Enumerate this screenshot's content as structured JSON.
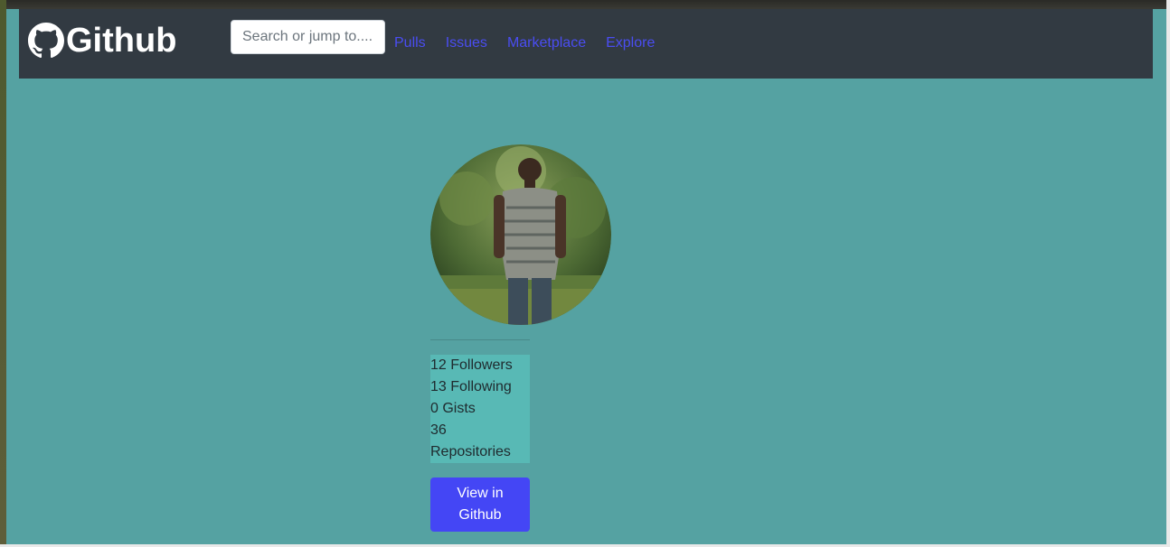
{
  "navbar": {
    "brand_icon": "github-octocat-icon",
    "brand": "Github",
    "search_placeholder": "Search or jump to....",
    "links": [
      "Pulls",
      "Issues",
      "Marketplace",
      "Explore"
    ],
    "link_color": "#4a4df2",
    "background": "#323a42"
  },
  "page": {
    "background": "#55a2a2"
  },
  "profile": {
    "followers": "12 Followers",
    "following": "13 Following",
    "gists": "0 Gists",
    "repos_count": "36",
    "repos_label": "Repositories",
    "button_label": "View in Github",
    "button_color": "#4446f5",
    "stats_background": "#58b9b5"
  }
}
